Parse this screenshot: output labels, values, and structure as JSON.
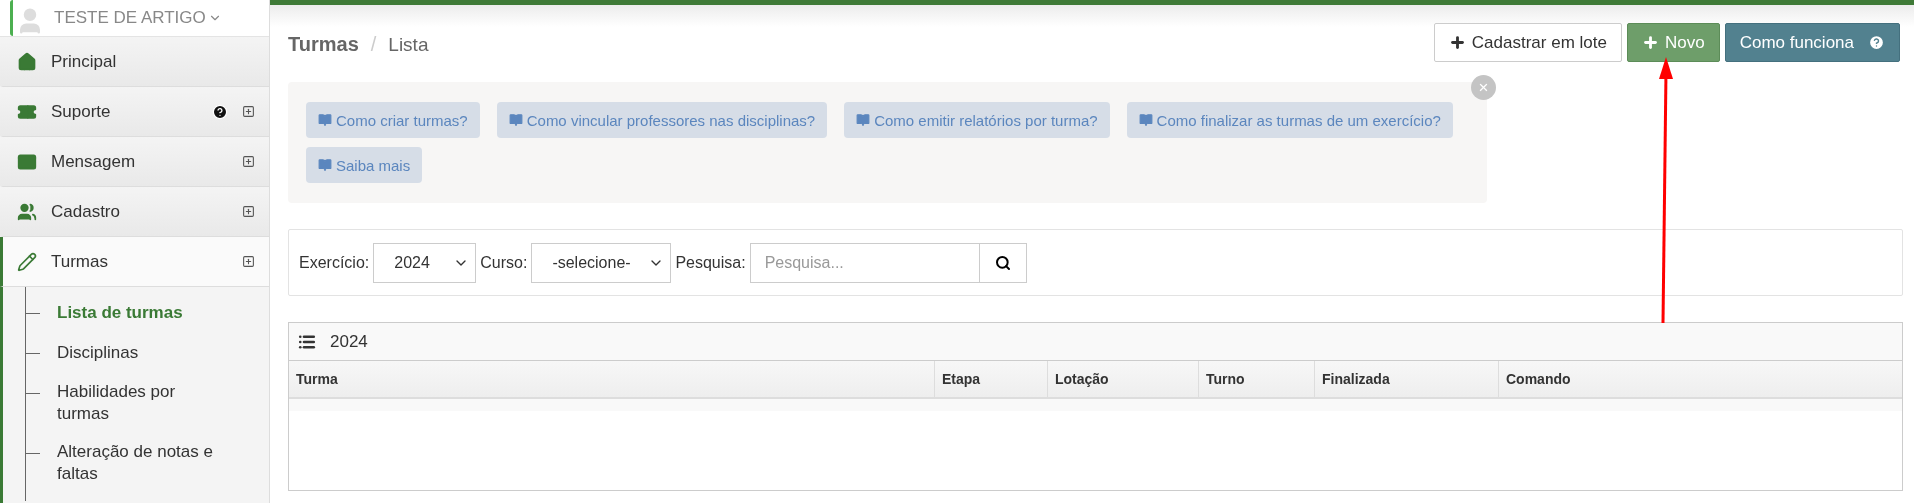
{
  "sidebar": {
    "user": {
      "name": "TESTE DE ARTIGO"
    },
    "items": [
      {
        "label": "Principal",
        "selected": false,
        "expandable": false
      },
      {
        "label": "Suporte",
        "selected": false,
        "expandable": true
      },
      {
        "label": "Mensagem",
        "selected": false,
        "expandable": true
      },
      {
        "label": "Cadastro",
        "selected": false,
        "expandable": true
      },
      {
        "label": "Turmas",
        "selected": true,
        "expandable": true,
        "children": [
          {
            "label": "Lista de turmas",
            "selected": true
          },
          {
            "label": "Disciplinas",
            "selected": false
          },
          {
            "label": "Habilidades por turmas",
            "selected": false
          },
          {
            "label": "Alteração de notas e faltas",
            "selected": false
          }
        ]
      }
    ]
  },
  "breadcrumb": {
    "title": "Turmas",
    "separator": "/",
    "current": "Lista"
  },
  "actions": [
    {
      "label": "Cadastrar em lote",
      "kind": "outline"
    },
    {
      "label": "Novo",
      "kind": "success"
    },
    {
      "label": "Como funciona",
      "kind": "info"
    }
  ],
  "help_links": [
    "Como criar turmas?",
    "Como vincular professores nas disciplinas?",
    "Como emitir relatórios por turma?",
    "Como finalizar as turmas de um exercício?",
    "Saiba mais"
  ],
  "close": "×",
  "filters": {
    "exercicio": {
      "label": "Exercício:",
      "value": "2024"
    },
    "curso": {
      "label": "Curso:",
      "value": "-selecione-"
    },
    "pesquisa": {
      "label": "Pesquisa:",
      "placeholder": "Pesquisa..."
    }
  },
  "table": {
    "title": "2024",
    "columns": [
      "Turma",
      "Etapa",
      "Lotação",
      "Turno",
      "Finalizada",
      "Comando"
    ]
  }
}
